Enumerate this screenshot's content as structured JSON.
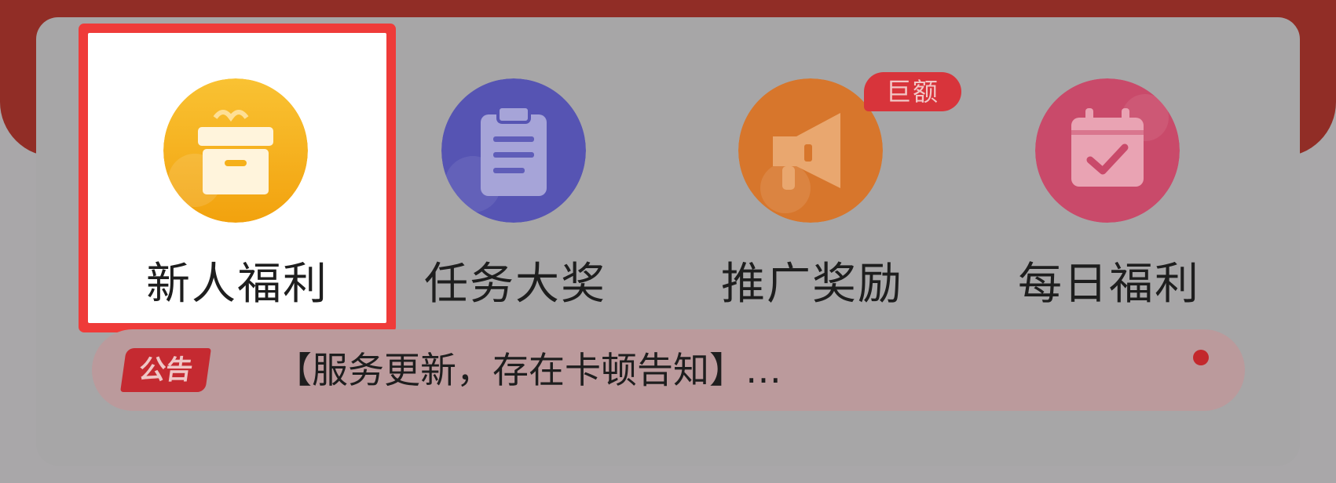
{
  "grid": {
    "items": [
      {
        "label": "新人福利",
        "icon": "gift-box-icon",
        "color": "#f5b01b",
        "highlighted": true
      },
      {
        "label": "任务大奖",
        "icon": "clipboard-icon",
        "color": "#5654b3"
      },
      {
        "label": "推广奖励",
        "icon": "megaphone-icon",
        "color": "#d7762c"
      },
      {
        "label": "每日福利",
        "icon": "calendar-check-icon",
        "color": "#c94a6a"
      }
    ]
  },
  "badge": {
    "text": "巨额"
  },
  "notice": {
    "tag": "公告",
    "text": "【服务更新，存在卡顿告知】…"
  },
  "colors": {
    "header_red": "#912d26",
    "highlight_border": "#ef3b39",
    "badge_red": "#d8343b"
  }
}
